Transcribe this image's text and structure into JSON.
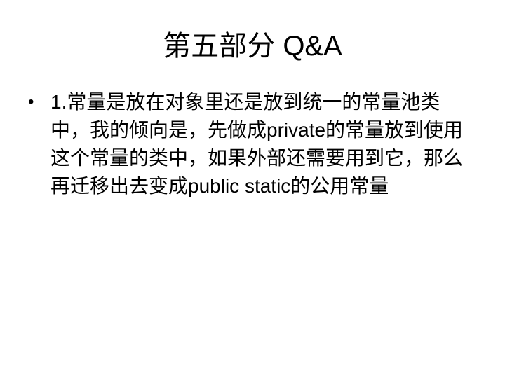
{
  "slide": {
    "title": "第五部分 Q&A",
    "bullets": [
      {
        "glyph": "•",
        "text": "1.常量是放在对象里还是放到统一的常量池类中，我的倾向是，先做成private的常量放到使用这个常量的类中，如果外部还需要用到它，那么再迁移出去变成public static的公用常量"
      }
    ]
  }
}
